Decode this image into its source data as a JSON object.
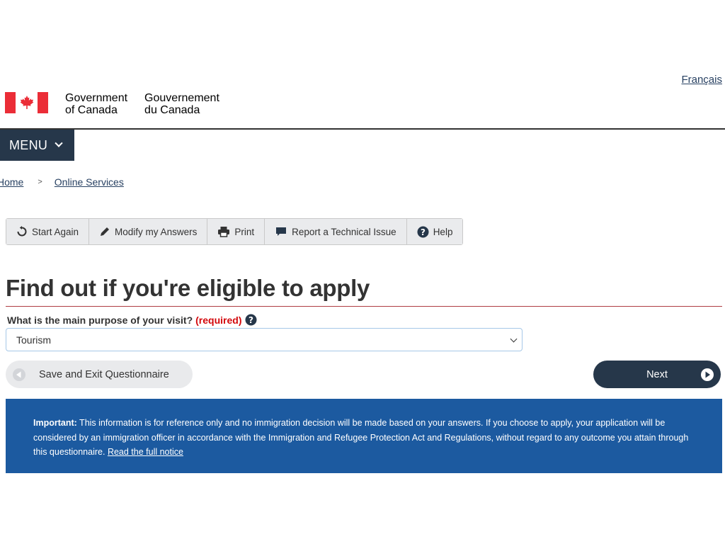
{
  "header": {
    "language_link": "Français",
    "sig_en_line1": "Government",
    "sig_en_line2": "of Canada",
    "sig_fr_line1": "Gouvernement",
    "sig_fr_line2": "du Canada",
    "flag_colors": {
      "red": "#eb2d37",
      "white": "#ffffff"
    }
  },
  "menu": {
    "label": "MENU",
    "icon": "chevron-down-icon"
  },
  "breadcrumb": [
    {
      "label": "Home"
    },
    {
      "label": "Online Services"
    }
  ],
  "breadcrumb_separator": ">",
  "toolbar": {
    "buttons": [
      {
        "label": "Start Again",
        "icon": "refresh-icon"
      },
      {
        "label": "Modify my Answers",
        "icon": "pencil-icon"
      },
      {
        "label": "Print",
        "icon": "printer-icon"
      },
      {
        "label": "Report a Technical Issue",
        "icon": "comment-icon"
      },
      {
        "label": "Help",
        "icon": "question-circle-icon"
      }
    ]
  },
  "main": {
    "title": "Find out if you're eligible to apply",
    "question": {
      "label": "What is the main purpose of your visit?",
      "required_text": "(required)",
      "selected_value": "Tourism"
    },
    "save_exit_label": "Save and Exit Questionnaire",
    "next_label": "Next"
  },
  "notice": {
    "important_label": "Important:",
    "text": " This information is for reference only and no immigration decision will be made based on your answers. If you choose to apply, your application will be considered by an immigration officer in accordance with the Immigration and Refugee Protection Act and Regulations, without regard to any outcome you attain through this questionnaire. ",
    "link_text": "Read the full notice"
  },
  "colors": {
    "brand_dark": "#26374a",
    "link": "#284162",
    "notice_bg": "#1c5aa0",
    "required": "#d3080c",
    "title_rule": "#af3c43"
  }
}
